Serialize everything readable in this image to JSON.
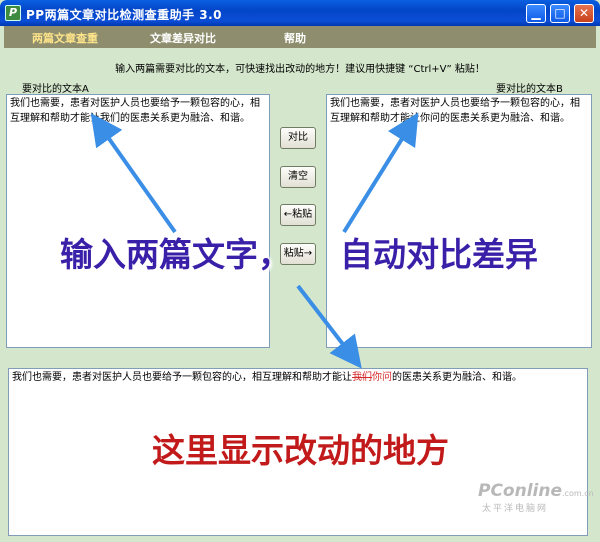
{
  "window": {
    "title": "PP两篇文章对比检测查重助手 3.0",
    "app_icon_glyph": "P",
    "minimize_glyph": "▁",
    "maximize_glyph": "□",
    "close_glyph": "✕"
  },
  "menu": {
    "items": [
      "两篇文章查重",
      "文章差异对比",
      "帮助"
    ]
  },
  "hint": "输入两篇需要对比的文本，可快速找出改动的地方！建议用快捷键 “Ctrl+V” 粘贴！",
  "panel_a": {
    "label": "要对比的文本A",
    "text": "我们也需要，患者对医护人员也要给予一颗包容的心，相互理解和帮助才能让我们的医患关系更为融洽、和谐。"
  },
  "panel_b": {
    "label": "要对比的文本B",
    "text": "我们也需要，患者对医护人员也要给予一颗包容的心，相互理解和帮助才能让你问的医患关系更为融洽、和谐。"
  },
  "buttons": {
    "compare": "对比",
    "clear": "清空",
    "paste_left": "←粘贴",
    "paste_right": "粘贴→"
  },
  "result": {
    "text_before": "我们也需要，患者对医护人员也要给予一颗包容的心，相互理解和帮助才能让",
    "deleted": "我们",
    "inserted": "你问",
    "text_after": "的医患关系更为融洽、和谐。"
  },
  "overlays": {
    "left_caption": "输入两篇文字，",
    "right_caption": "自动对比差异",
    "bottom_caption": "这里显示改动的地方",
    "arrow_color": "#3a8ee6"
  },
  "watermark": {
    "brand": "PConline",
    "domain": ".com.cn",
    "cn_name": "太平洋电脑网"
  }
}
